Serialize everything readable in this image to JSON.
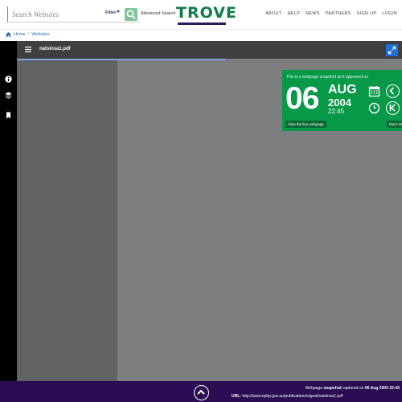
{
  "header": {
    "search_placeholder": "Search Websites",
    "filter_label": "Filter",
    "advanced_search_label": "Advanced Search",
    "logo_text": "TROVE",
    "nav": [
      "ABOUT",
      "HELP",
      "NEWS",
      "PARTNERS",
      "SIGN UP",
      "LOGIN"
    ]
  },
  "breadcrumb": {
    "home": "Home",
    "separator": "/",
    "current": "Websites"
  },
  "left_rail": {
    "icons": [
      "info-icon",
      "layers-icon",
      "bookmark-icon"
    ]
  },
  "viewer": {
    "document_title": "natsinsa1.pdf",
    "expand_icon": "expand-icon",
    "menu_icon": "hamburger-icon"
  },
  "snapshot": {
    "heading": "This is a webpage snapshot as it appeared on",
    "day": "06",
    "month": "AUG",
    "year": "2004",
    "time": "22:45",
    "live_link_label": "View the live webpage",
    "more_label": "More sn",
    "icons": [
      "calendar-icon",
      "clock-icon",
      "previous-icon",
      "first-icon"
    ]
  },
  "footer": {
    "prefix": "Webpage",
    "snapshot_word": "snapshot",
    "captured_text": "captured on",
    "captured_date": "06 Aug 2004 22:45",
    "url_label": "URL:",
    "url": "http://www.nphp.gov.au/publications/signal/natsinsa1.pdf"
  },
  "colors": {
    "brand_green": "#079848",
    "brand_purple": "#2a0d52",
    "search_button": "#7ec5a0",
    "link_blue": "#2a6fb5",
    "expand_button": "#1f6fd6"
  }
}
